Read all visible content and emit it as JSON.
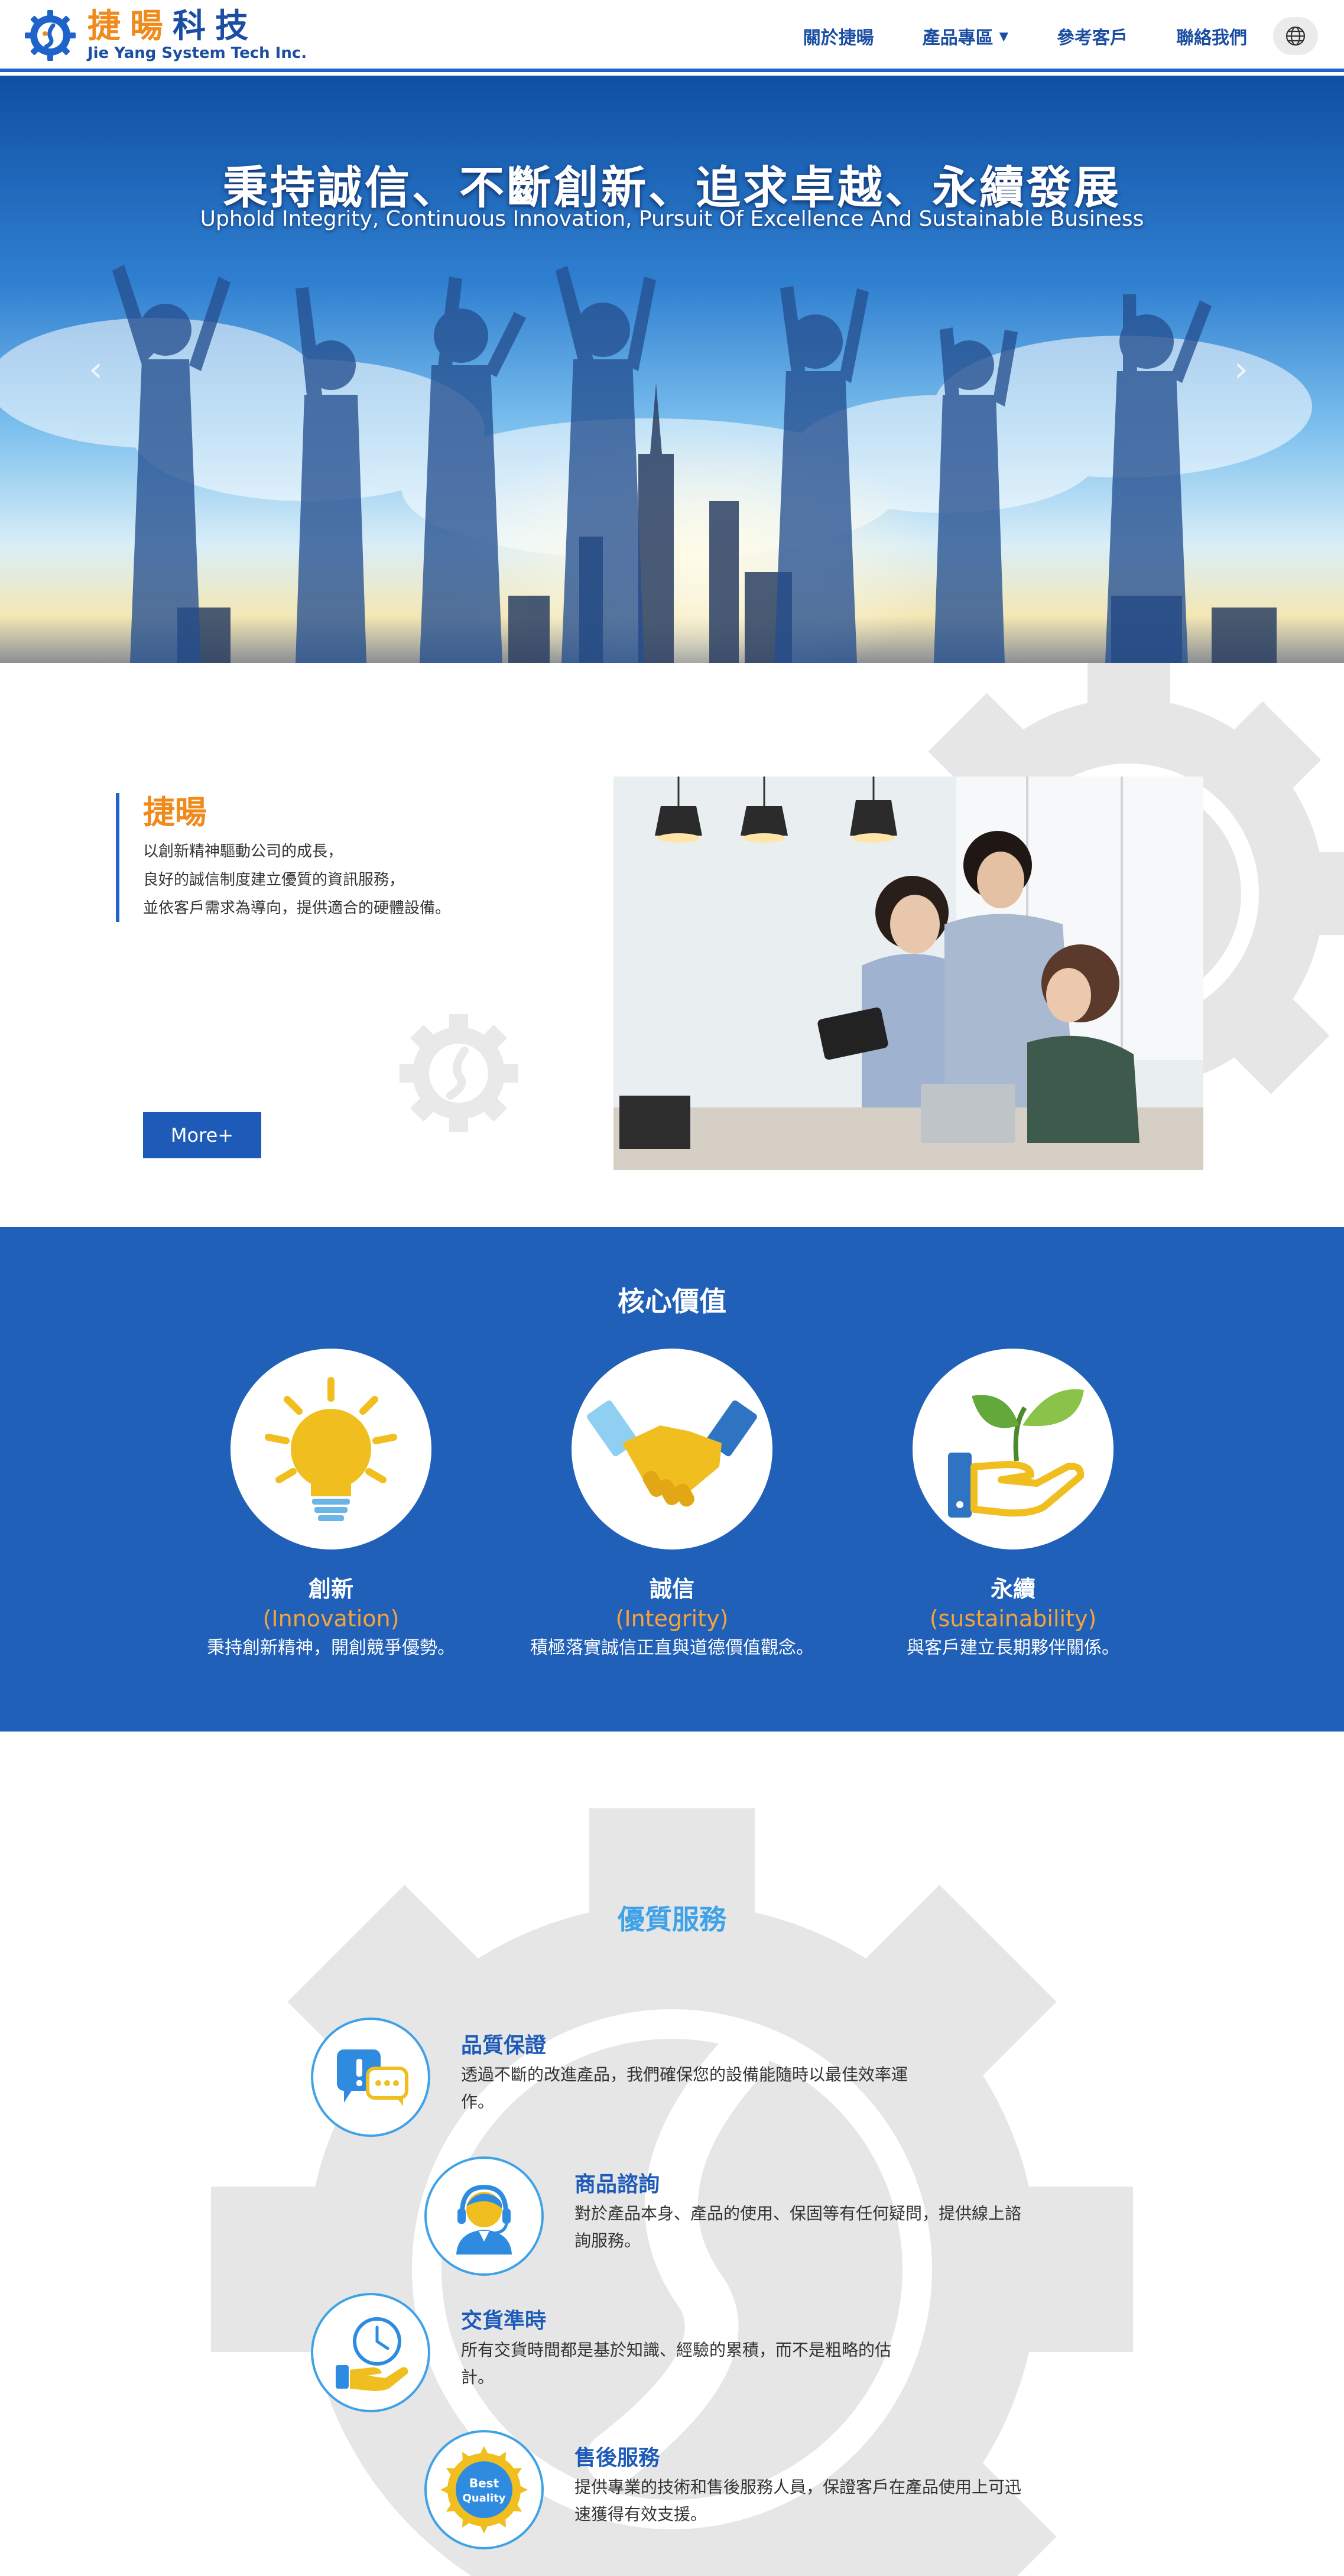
{
  "header": {
    "logo_cn_1": "捷暘",
    "logo_cn_2": "科技",
    "logo_en": "Jie Yang System Tech Inc.",
    "nav": [
      "關於捷暘",
      "產品專區",
      "參考客戶",
      "聯絡我們"
    ],
    "language_icon": "globe-icon"
  },
  "hero": {
    "title": "秉持誠信、不斷創新、追求卓越、永續發展",
    "subtitle": "Uphold Integrity, Continuous  Innovation, Pursuit Of Excellence And Sustainable Business",
    "prev_icon": "chevron-left-icon",
    "next_icon": "chevron-right-icon"
  },
  "about": {
    "title": "捷暘",
    "lines": [
      "以創新精神驅動公司的成長，",
      "良好的誠信制度建立優質的資訊服務，",
      "並依客戶需求為導向，提供適合的硬體設備。"
    ],
    "more_label": "More+"
  },
  "core": {
    "title": "核心價值",
    "values": [
      {
        "name": "創新",
        "en": "(Innovation)",
        "desc": "秉持創新精神，開創競爭優勢。",
        "icon": "lightbulb-icon"
      },
      {
        "name": "誠信",
        "en": "(Integrity)",
        "desc": "積極落實誠信正直與道德價值觀念。",
        "icon": "handshake-icon"
      },
      {
        "name": "永續",
        "en": "(sustainability)",
        "desc": "與客戶建立長期夥伴關係。",
        "icon": "sprout-hand-icon"
      }
    ]
  },
  "services": {
    "title": "優質服務",
    "items": [
      {
        "name": "品質保證",
        "desc": "透過不斷的改進產品，我們確保您的設備能隨時以最佳效率運作。",
        "icon": "chat-alert-icon"
      },
      {
        "name": "商品諮詢",
        "desc": "對於產品本身、產品的使用、保固等有任何疑問，提供線上諮詢服務。",
        "icon": "headset-agent-icon"
      },
      {
        "name": "交貨準時",
        "desc": "所有交貨時間都是基於知識、經驗的累積，而不是粗略的估計。",
        "icon": "clock-hand-icon"
      },
      {
        "name": "售後服務",
        "desc": "提供專業的技術和售後服務人員，保證客戶在產品使用上可迅速獲得有效支援。",
        "icon": "best-quality-badge-icon"
      }
    ],
    "badge_line1": "Best",
    "badge_line2": "Quality"
  },
  "colors": {
    "brand_blue": "#1e5bb8",
    "accent_orange": "#f08a1c",
    "light_blue": "#3fa2e8"
  }
}
